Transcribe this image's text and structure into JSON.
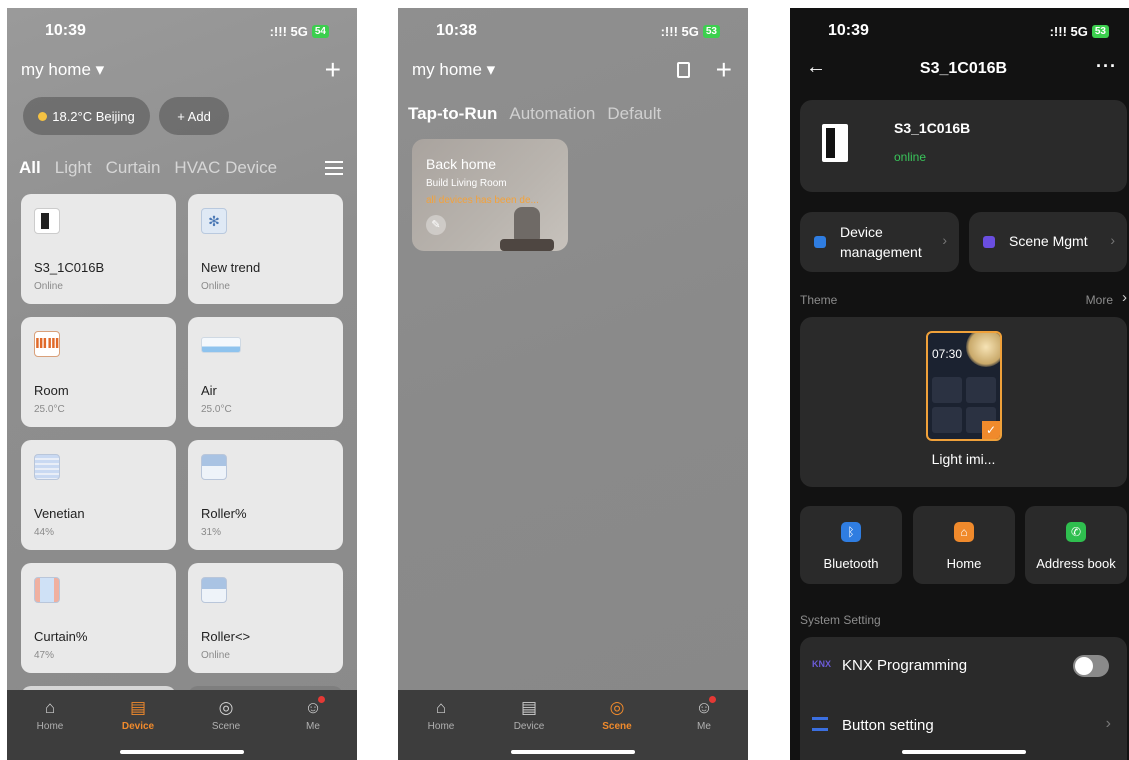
{
  "panel_device": {
    "status_time": "10:39",
    "signal": ":!!! 5G",
    "battery": "54",
    "home_selector": "my home ▾",
    "add_glyph": "+",
    "weather": "18.2°C Beijing",
    "add_label": "+ Add",
    "tabs": [
      "All",
      "Light",
      "Curtain",
      "HVAC Device"
    ],
    "devices": [
      {
        "name": "S3_1C016B",
        "status": "Online",
        "icon": "switch-panel-icon"
      },
      {
        "name": "New trend",
        "status": "Online",
        "icon": "fan-icon"
      },
      {
        "name": "Room",
        "status": "25.0°C",
        "icon": "floor-heating-icon"
      },
      {
        "name": "Air",
        "status": "25.0°C",
        "icon": "air-conditioner-icon"
      },
      {
        "name": "Venetian",
        "status": "44%",
        "icon": "venetian-blind-icon"
      },
      {
        "name": "Roller%",
        "status": "31%",
        "icon": "roller-blind-icon"
      },
      {
        "name": "Curtain%",
        "status": "47%",
        "icon": "curtain-icon"
      },
      {
        "name": "Roller<>",
        "status": "Online",
        "icon": "roller-blind-icon"
      }
    ],
    "nav": [
      "Home",
      "Device",
      "Scene",
      "Me"
    ]
  },
  "panel_scene": {
    "status_time": "10:38",
    "signal": ":!!! 5G",
    "battery": "53",
    "home_selector": "my home ▾",
    "add_glyph": "+",
    "tabs": [
      "Tap-to-Run",
      "Automation",
      "Default"
    ],
    "scene": {
      "title": "Back home",
      "subtitle": "Build  Living Room",
      "warning": "all devices has been de..."
    },
    "nav": [
      "Home",
      "Device",
      "Scene",
      "Me"
    ]
  },
  "panel_detail": {
    "status_time": "10:39",
    "signal": ":!!! 5G",
    "battery": "53",
    "title": "S3_1C016B",
    "device_name": "S3_1C016B",
    "device_status": "online",
    "device_mgmt": "Device management",
    "scene_mgmt": "Scene Mgmt",
    "theme_label": "Theme",
    "more_label": "More",
    "theme_clock": "07:30",
    "theme_name": "Light imi...",
    "quick": [
      {
        "label": "Bluetooth",
        "icon": "bluetooth-icon",
        "color": "#2f7de1"
      },
      {
        "label": "Home",
        "icon": "home-icon",
        "color": "#f08a2c"
      },
      {
        "label": "Address book",
        "icon": "phone-icon",
        "color": "#2fbf4f"
      }
    ],
    "system_label": "System Setting",
    "knx": "KNX Programming",
    "button_setting": "Button setting"
  }
}
